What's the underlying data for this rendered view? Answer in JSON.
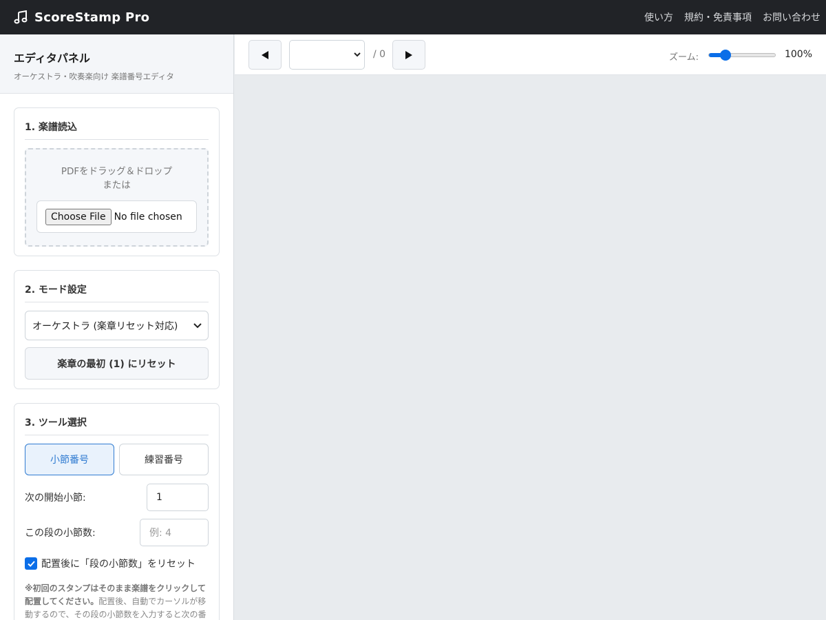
{
  "app": {
    "title": "ScoreStamp Pro",
    "icon": "music-note-icon"
  },
  "topnav": [
    "使い方",
    "規約・免責事項",
    "お問い合わせ"
  ],
  "sidebar": {
    "title": "エディタパネル",
    "subtitle": "オーケストラ・吹奏楽向け 楽譜番号エディタ"
  },
  "section_load": {
    "title": "1. 楽譜読込",
    "drop_line1": "PDFをドラッグ＆ドロップ",
    "drop_line2": "または",
    "file_button": "Choose File",
    "file_status": "No file chosen"
  },
  "section_mode": {
    "title": "2. モード設定",
    "mode_selected": "オーケストラ (楽章リセット対応)",
    "reset_button": "楽章の最初 (1) にリセット"
  },
  "section_tool": {
    "title": "3. ツール選択",
    "tools": [
      "小節番号",
      "練習番号"
    ],
    "active_tool": "小節番号",
    "start_label": "次の開始小節:",
    "start_value": "1",
    "count_label": "この段の小節数:",
    "count_placeholder": "例: 4",
    "reset_check_label": "配置後に「段の小節数」をリセット",
    "reset_checked": true,
    "note_bold": "※初回のスタンプはそのまま楽譜をクリックして配置してください。",
    "note_text": "配置後、自動でカーソルが移動するので、その段の小節数を入力すると次の番"
  },
  "toolbar": {
    "prev_icon": "triangle-left-icon",
    "next_icon": "triangle-right-icon",
    "page_selected": "",
    "page_total": "/ 0",
    "zoom_label": "ズーム:",
    "zoom_value": "100%",
    "zoom_level": 0.2
  },
  "colors": {
    "header_bg": "#212327",
    "accent": "#0b6ee8",
    "active_tool": "#2f7bd1",
    "canvas_bg": "#e8ebee"
  }
}
